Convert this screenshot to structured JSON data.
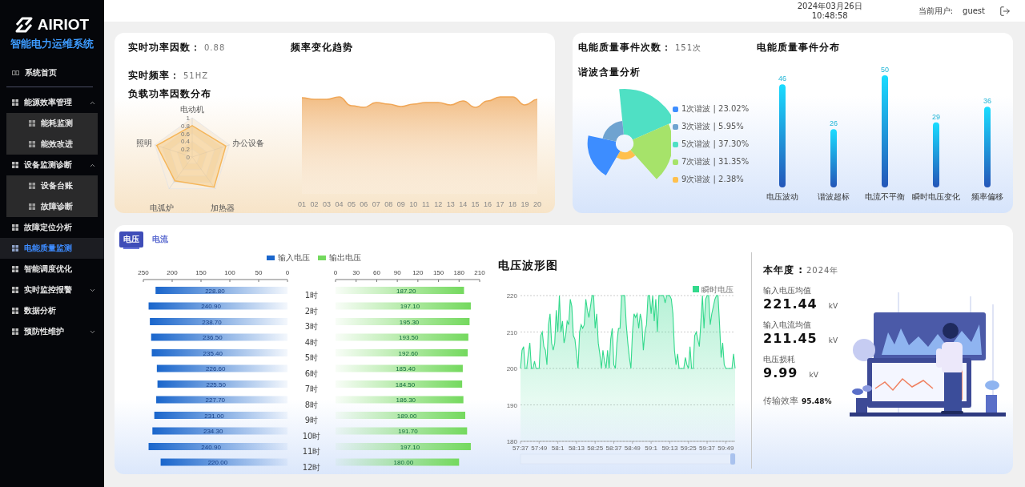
{
  "header": {
    "date": "2024年03月26日",
    "time": "10:48:58",
    "user_label": "当前用户:",
    "user": "guest"
  },
  "sidebar": {
    "logo": "AIRIOT",
    "subtitle": "智能电力运维系统",
    "items": [
      {
        "label": "系统首页",
        "kind": "home",
        "selected": false
      },
      {
        "label": "能源效率管理",
        "kind": "menu",
        "selected": false,
        "expanded": true,
        "children": [
          {
            "label": "能耗监测",
            "selected": false
          },
          {
            "label": "能效改进",
            "selected": false
          }
        ]
      },
      {
        "label": "设备监测诊断",
        "kind": "menu",
        "selected": false,
        "expanded": true,
        "children": [
          {
            "label": "设备台账",
            "selected": false
          },
          {
            "label": "故障诊断",
            "selected": false
          }
        ]
      },
      {
        "label": "故障定位分析",
        "kind": "menu",
        "selected": false
      },
      {
        "label": "电能质量监测",
        "kind": "menu",
        "selected": true
      },
      {
        "label": "智能调度优化",
        "kind": "menu",
        "selected": false
      },
      {
        "label": "实时监控报警",
        "kind": "menu",
        "selected": false,
        "expanded": false
      },
      {
        "label": "数据分析",
        "kind": "menu",
        "selected": false
      },
      {
        "label": "预防性维护",
        "kind": "menu",
        "selected": false,
        "expanded": false
      }
    ]
  },
  "power_card": {
    "power_factor_label": "实时功率因数：",
    "power_factor": "0.88",
    "trend_title": "频率变化趋势",
    "frequency_label": "实时频率：",
    "frequency": "51HZ",
    "radar_title": "负载功率因数分布",
    "radar_axes": [
      "电动机",
      "办公设备",
      "加热器",
      "电弧炉",
      "照明"
    ],
    "radar_ticks": [
      "1",
      "0.8",
      "0.6",
      "0.4",
      "0.2",
      "0"
    ],
    "trend_x_labels": [
      "01",
      "02",
      "03",
      "04",
      "05",
      "06",
      "07",
      "08",
      "09",
      "10",
      "11",
      "12",
      "13",
      "14",
      "15",
      "16",
      "17",
      "18",
      "19",
      "20"
    ]
  },
  "quality_card": {
    "events_label": "电能质量事件次数：",
    "events": "151次",
    "events_title": "电能质量事件分布",
    "harmonic_title": "谐波含量分析",
    "harmonic_legend": [
      {
        "label": "1次谐波 | 23.02%",
        "color": "#3d8dff"
      },
      {
        "label": "3次谐波 | 5.95%",
        "color": "#6fa3d0"
      },
      {
        "label": "5次谐波 | 37.30%",
        "color": "#4fe0c4"
      },
      {
        "label": "7次谐波 | 31.35%",
        "color": "#a6e36a"
      },
      {
        "label": "9次谐波 | 2.38%",
        "color": "#ffc04d"
      }
    ],
    "events_chart": {
      "chart_data": {
        "type": "bar",
        "categories": [
          "电压波动",
          "谐波超标",
          "电流不平衡",
          "瞬时电压变化",
          "频率偏移"
        ],
        "values": [
          46,
          26,
          50,
          29,
          36
        ],
        "data_labels": true
      }
    }
  },
  "bottom": {
    "tabs": [
      {
        "label": "电压",
        "selected": true
      },
      {
        "label": "电流",
        "selected": false
      }
    ],
    "input_chart": {
      "chart_data": {
        "type": "bar",
        "orientation": "horizontal",
        "categories": [
          "1时",
          "2时",
          "3时",
          "4时",
          "5时",
          "6时",
          "7时",
          "8时",
          "9时",
          "10时",
          "11时",
          "12时"
        ],
        "series": [
          {
            "name": "输入电压",
            "color": "#1a66cc",
            "values": [
              228.8,
              240.9,
              238.7,
              236.5,
              235.4,
              226.6,
              225.5,
              227.7,
              231.0,
              234.3,
              240.9,
              220.0
            ]
          }
        ],
        "xlim": [
          250,
          0
        ],
        "xticks": [
          250,
          200,
          150,
          100,
          50,
          0
        ],
        "value_labels": [
          "228.80",
          "240.90",
          "238.70",
          "236.50",
          "235.40",
          "226.60",
          "225.50",
          "227.70",
          "231.00",
          "234.30",
          "240.90",
          "220.00"
        ]
      }
    },
    "output_chart": {
      "chart_data": {
        "type": "bar",
        "orientation": "horizontal",
        "series": [
          {
            "name": "输出电压",
            "color": "#74d95e",
            "values": [
              187.2,
              197.1,
              195.3,
              193.5,
              192.6,
              185.4,
              184.5,
              186.3,
              189.0,
              191.7,
              197.1,
              180.0
            ]
          }
        ],
        "xlim": [
          0,
          210
        ],
        "xticks": [
          0,
          30,
          60,
          90,
          120,
          150,
          180,
          210
        ],
        "value_labels": [
          "187.20",
          "197.10",
          "195.30",
          "193.50",
          "192.60",
          "185.40",
          "184.50",
          "186.30",
          "189.00",
          "191.70",
          "197.10",
          "180.00"
        ]
      }
    },
    "wave_title": "电压波形图",
    "wave_chart": {
      "chart_data": {
        "type": "area",
        "series": [
          {
            "name": "瞬时电压",
            "color": "#33d98c",
            "values": [
              200,
              205,
              206,
              200,
              200,
              204,
              207,
              200,
              200,
              202,
              200,
              200,
              200,
              209,
              210,
              206,
              205,
              201,
              212,
              215,
              207,
              205,
              207,
              216,
              210,
              220,
              210,
              213,
              207,
              209,
              213,
              212,
              219,
              217,
              209,
              208,
              204,
              200,
              210,
              212,
              211,
              212,
              219,
              216,
              214,
              217,
              220,
              220,
              211,
              215,
              207,
              204,
              200,
              205,
              202,
              200,
              205,
              200,
              208,
              211,
              201,
              200,
              207,
              211,
              211,
              220,
              220,
              220,
              212,
              207,
              203,
              200,
              210,
              215,
              214,
              215,
              211,
              215,
              213,
              205,
              210,
              212,
              220,
              220,
              215,
              220,
              213,
              219,
              210,
              220,
              220,
              220,
              220,
              218,
              220,
              220,
              220,
              219,
              215,
              205,
              201,
              204,
              200,
              200,
              200,
              200,
              203,
              201,
              200,
              206,
              200,
              200,
              209,
              210,
              208,
              206,
              213,
              220,
              211,
              219,
              220,
              220,
              212,
              215,
              217,
              219,
              220,
              220,
              212,
              203,
              207,
              201,
              200,
              200,
              200,
              200,
              200,
              204,
              200
            ]
          }
        ],
        "ylim": [
          180,
          220
        ],
        "yticks": [
          180,
          190,
          200,
          210,
          220
        ],
        "grid": true
      },
      "time_labels": [
        "57:37",
        "57:49",
        "58:1",
        "58:13",
        "58:25",
        "58:37",
        "58:49",
        "59:1",
        "59:13",
        "59:25",
        "59:37",
        "59:49"
      ]
    },
    "stats": {
      "year_label": "本年度 :",
      "year": "2024年",
      "metrics": [
        {
          "label": "输入电压均值",
          "value": "221.44",
          "unit": "kV"
        },
        {
          "label": "输入电流均值",
          "value": "211.45",
          "unit": "kV"
        },
        {
          "label": "电压损耗",
          "value": "9.99",
          "unit": "kV"
        }
      ],
      "efficiency_label": "传输效率",
      "efficiency": "95.48%"
    }
  }
}
